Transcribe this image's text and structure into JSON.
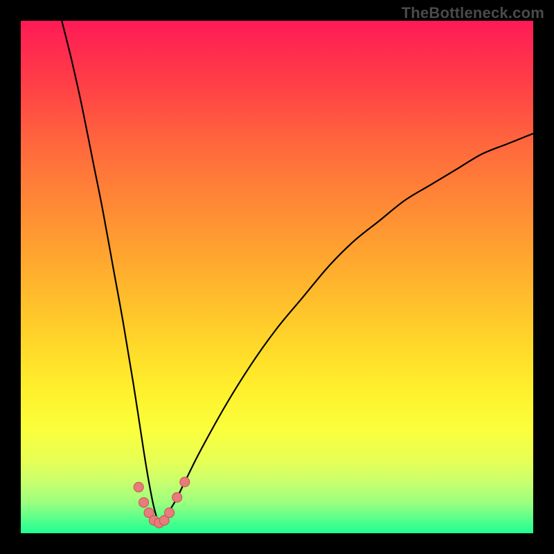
{
  "watermark": {
    "text": "TheBottleneck.com"
  },
  "colors": {
    "page_bg": "#000000",
    "gradient_top": "#ff1a56",
    "gradient_mid": "#ffd429",
    "gradient_bottom": "#1eff93",
    "curve_stroke": "#000000",
    "marker_fill": "#e87b7b",
    "marker_stroke": "#c94f4f"
  },
  "chart_data": {
    "type": "line",
    "title": "",
    "xlabel": "",
    "ylabel": "",
    "xlim": [
      0,
      100
    ],
    "ylim": [
      0,
      100
    ],
    "grid": false,
    "legend": false,
    "note": "Axes are implicit (no visible tick labels). Values are estimated from pixel positions on a 0–100 normalized scale where y=0 is the bottom (green) and y=100 is the top (red). The curve is a V-shaped bottleneck profile with its minimum near x≈27.",
    "series": [
      {
        "name": "bottleneck-curve",
        "x": [
          8,
          10,
          12,
          14,
          16,
          18,
          20,
          22,
          24,
          25,
          26,
          27,
          28,
          30,
          32,
          35,
          40,
          45,
          50,
          55,
          60,
          65,
          70,
          75,
          80,
          85,
          90,
          95,
          100
        ],
        "y": [
          100,
          92,
          83,
          73,
          63,
          52,
          41,
          29,
          16,
          10,
          5,
          2,
          3,
          6,
          10,
          16,
          25,
          33,
          40,
          46,
          52,
          57,
          61,
          65,
          68,
          71,
          74,
          76,
          78
        ]
      }
    ],
    "markers": {
      "name": "minimum-region-dots",
      "points": [
        {
          "x": 23.0,
          "y": 9.0
        },
        {
          "x": 24.0,
          "y": 6.0
        },
        {
          "x": 25.0,
          "y": 4.0
        },
        {
          "x": 26.0,
          "y": 2.5
        },
        {
          "x": 27.0,
          "y": 2.0
        },
        {
          "x": 28.0,
          "y": 2.5
        },
        {
          "x": 29.0,
          "y": 4.0
        },
        {
          "x": 30.5,
          "y": 7.0
        },
        {
          "x": 32.0,
          "y": 10.0
        }
      ]
    }
  }
}
